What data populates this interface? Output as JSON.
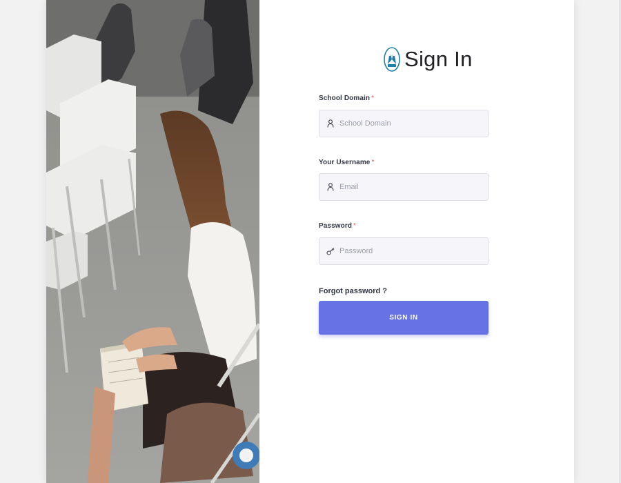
{
  "header": {
    "title": "Sign In",
    "logo_icon": "raised-hands-logo-icon"
  },
  "form": {
    "fields": [
      {
        "label": "School Domain",
        "required_mark": "*",
        "placeholder": "School Domain",
        "value": "",
        "icon": "user-icon"
      },
      {
        "label": "Your Username",
        "required_mark": "*",
        "placeholder": "Email",
        "value": "",
        "icon": "user-icon"
      },
      {
        "label": "Password",
        "required_mark": "*",
        "placeholder": "Password",
        "value": "",
        "icon": "key-icon"
      }
    ],
    "forgot_password": "Forgot password ?",
    "submit_label": "SIGN IN"
  },
  "colors": {
    "accent": "#6772e5",
    "required": "#e05a5a",
    "page_background": "#f2f2f3",
    "field_background": "#f6f6fa",
    "logo": "#1f7fa6"
  }
}
